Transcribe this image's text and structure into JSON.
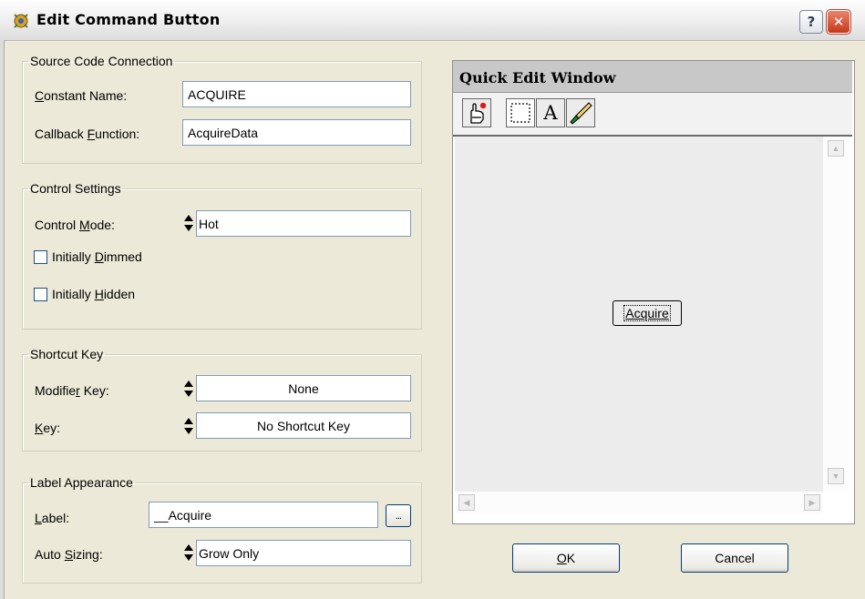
{
  "window": {
    "title": "Edit Command Button",
    "help_label": "?",
    "close_label": "✕"
  },
  "source_code": {
    "legend": "Source Code Connection",
    "constant_label_pre": "",
    "constant_label_u": "C",
    "constant_label_post": "onstant Name:",
    "constant_value": "ACQUIRE",
    "callback_label_pre": "Callback ",
    "callback_label_u": "F",
    "callback_label_post": "unction:",
    "callback_value": "AcquireData"
  },
  "control_settings": {
    "legend": "Control Settings",
    "mode_label_pre": "Control ",
    "mode_label_u": "M",
    "mode_label_post": "ode:",
    "mode_value": "Hot",
    "dimmed_pre": "Initially ",
    "dimmed_u": "D",
    "dimmed_post": "immed",
    "dimmed_checked": false,
    "hidden_pre": "Initially ",
    "hidden_u": "H",
    "hidden_post": "idden",
    "hidden_checked": false
  },
  "shortcut": {
    "legend": "Shortcut Key",
    "modifier_label_pre": "Modifie",
    "modifier_label_u": "r",
    "modifier_label_post": " Key:",
    "modifier_value": "None",
    "key_label_pre": "",
    "key_label_u": "K",
    "key_label_post": "ey:",
    "key_value": "No Shortcut Key"
  },
  "label_appearance": {
    "legend": "Label Appearance",
    "label_label_pre": "",
    "label_label_u": "L",
    "label_label_post": "abel:",
    "label_value": "__Acquire",
    "ellipsis": "...",
    "autosize_label_pre": "Auto ",
    "autosize_label_u": "S",
    "autosize_label_post": "izing:",
    "autosize_value": "Grow Only"
  },
  "quick_edit": {
    "title": "Quick Edit Window",
    "tools": [
      "operate-tool-icon",
      "select-tool-icon",
      "text-tool-icon",
      "color-tool-icon"
    ],
    "text_tool_glyph": "A",
    "preview_button_u": "A",
    "preview_button_rest": "cquire"
  },
  "buttons": {
    "ok_u": "O",
    "ok_rest": "K",
    "cancel": "Cancel"
  },
  "colors": {
    "dialog_bg": "#ece9d8",
    "field_border": "#7f9db9",
    "close_red": "#c4391c"
  }
}
